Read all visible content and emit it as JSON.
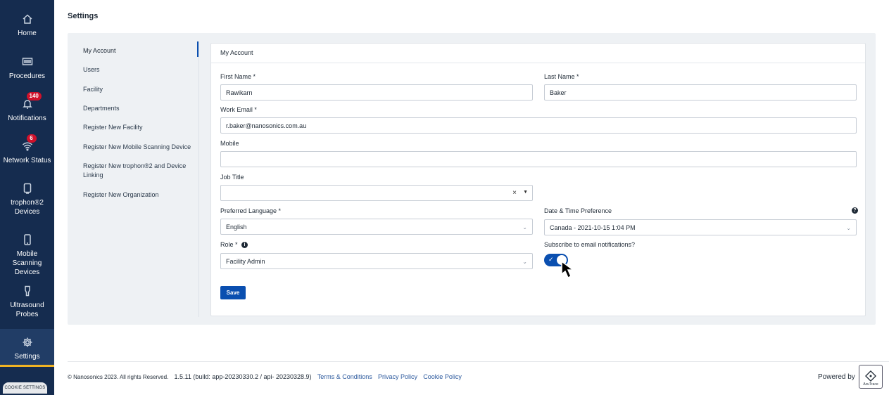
{
  "sidebar": {
    "items": [
      {
        "label": "Home",
        "icon": "home-icon"
      },
      {
        "label": "Procedures",
        "icon": "procedures-icon"
      },
      {
        "label": "Notifications",
        "icon": "bell-icon",
        "badge": "140"
      },
      {
        "label": "Network Status",
        "icon": "wifi-icon",
        "badge": "6"
      },
      {
        "label": "trophon®2 Devices",
        "icon": "device-icon"
      },
      {
        "label": "Mobile Scanning Devices",
        "icon": "mobile-icon"
      },
      {
        "label": "Ultrasound Probes",
        "icon": "probe-icon"
      },
      {
        "label": "Settings",
        "icon": "gear-icon",
        "active": true
      }
    ],
    "cookie_settings": "COOKIE SETTINGS"
  },
  "page": {
    "title": "Settings"
  },
  "subnav": {
    "items": [
      {
        "label": "My Account",
        "active": true
      },
      {
        "label": "Users"
      },
      {
        "label": "Facility"
      },
      {
        "label": "Departments"
      },
      {
        "label": "Register New Facility"
      },
      {
        "label": "Register New Mobile Scanning Device"
      },
      {
        "label": "Register New trophon®2 and Device Linking"
      },
      {
        "label": "Register New Organization"
      }
    ]
  },
  "form": {
    "heading": "My Account",
    "first_name": {
      "label": "First Name *",
      "value": "Rawikarn"
    },
    "last_name": {
      "label": "Last Name *",
      "value": "Baker"
    },
    "work_email": {
      "label": "Work Email *",
      "value": "r.baker@nanosonics.com.au"
    },
    "mobile": {
      "label": "Mobile",
      "value": ""
    },
    "job_title": {
      "label": "Job Title",
      "value": ""
    },
    "preferred_language": {
      "label": "Preferred Language  *",
      "value": "English"
    },
    "date_time": {
      "label": "Date & Time Preference",
      "value": "Canada - 2021-10-15 1:04 PM"
    },
    "role": {
      "label": "Role  *",
      "value": "Facility Admin"
    },
    "subscribe": {
      "label": "Subscribe to email notifications?",
      "checked": true
    },
    "save_label": "Save"
  },
  "footer": {
    "copyright": "© Nanosonics 2023. All rights Reserved.",
    "version": "1.5.11 (build: app-20230330.2 / api- 20230328.9)",
    "links": [
      "Terms & Conditions",
      "Privacy Policy",
      "Cookie Policy"
    ],
    "powered_by": "Powered by",
    "logo_text": "AcuTrace"
  },
  "colors": {
    "sidebar": "#152c4f",
    "accent": "#0a4fb0",
    "badge": "#d0112b",
    "active_underline": "#f0b323"
  }
}
